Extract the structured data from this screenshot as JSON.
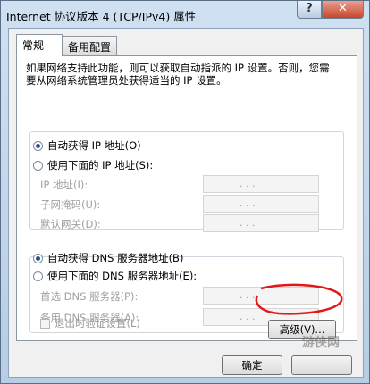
{
  "window": {
    "title": "Internet 协议版本 4 (TCP/IPv4) 属性",
    "help_label": "?",
    "close_label": "✕"
  },
  "tabs": [
    {
      "label": "常规"
    },
    {
      "label": "备用配置"
    }
  ],
  "description": "如果网络支持此功能，则可以获取自动指派的 IP 设置。否则，您需要从网络系统管理员处获得适当的 IP 设置。",
  "ip": {
    "auto_label": "自动获得 IP 地址(O)",
    "manual_label": "使用下面的 IP 地址(S):",
    "fields": [
      {
        "label": "IP 地址(I):"
      },
      {
        "label": "子网掩码(U):"
      },
      {
        "label": "默认网关(D):"
      }
    ]
  },
  "dns": {
    "auto_label": "自动获得 DNS 服务器地址(B)",
    "manual_label": "使用下面的 DNS 服务器地址(E):",
    "fields": [
      {
        "label": "首选 DNS 服务器(P):"
      },
      {
        "label": "备用 DNS 服务器(A):"
      }
    ]
  },
  "ip_dots": ".    .    .",
  "validate_label": "退出时验证设置(L)",
  "advanced_label": "高级(V)...",
  "ok_label": "确定",
  "watermark": "游侠网"
}
